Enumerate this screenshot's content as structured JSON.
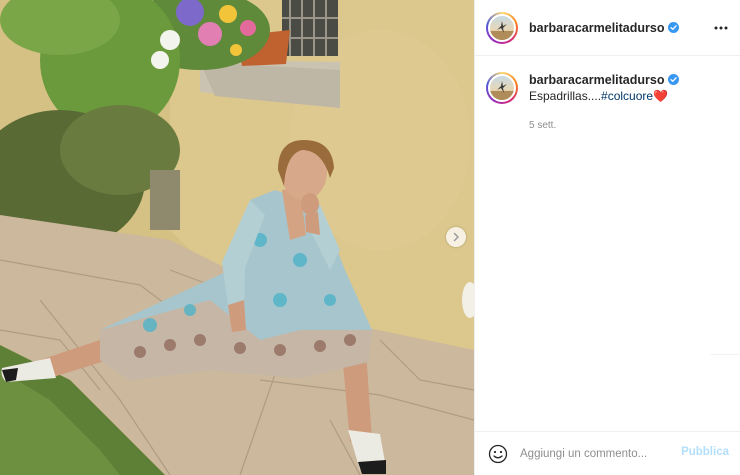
{
  "post": {
    "photo_alt": "",
    "next_icon": "chevron-right-icon"
  },
  "header": {
    "username": "barbaracarmelitadurso",
    "verified_icon": "verified-badge-icon",
    "more_icon": "more-horizontal-icon"
  },
  "caption": {
    "username": "barbaracarmelitadurso",
    "text": "Espadrillas....",
    "hashtag": "#colcuore",
    "emoji": "❤️",
    "timestamp": "5 sett."
  },
  "comment_bar": {
    "emoji_icon": "smiley-face-icon",
    "placeholder": "Aggiungi un commento...",
    "publish_label": "Pubblica"
  },
  "colors": {
    "verified_blue": "#3897f0",
    "hashtag_link": "#00376b",
    "publish_disabled": "#b2dffc",
    "secondary_text": "#8e8e8e",
    "border": "#efefef"
  }
}
